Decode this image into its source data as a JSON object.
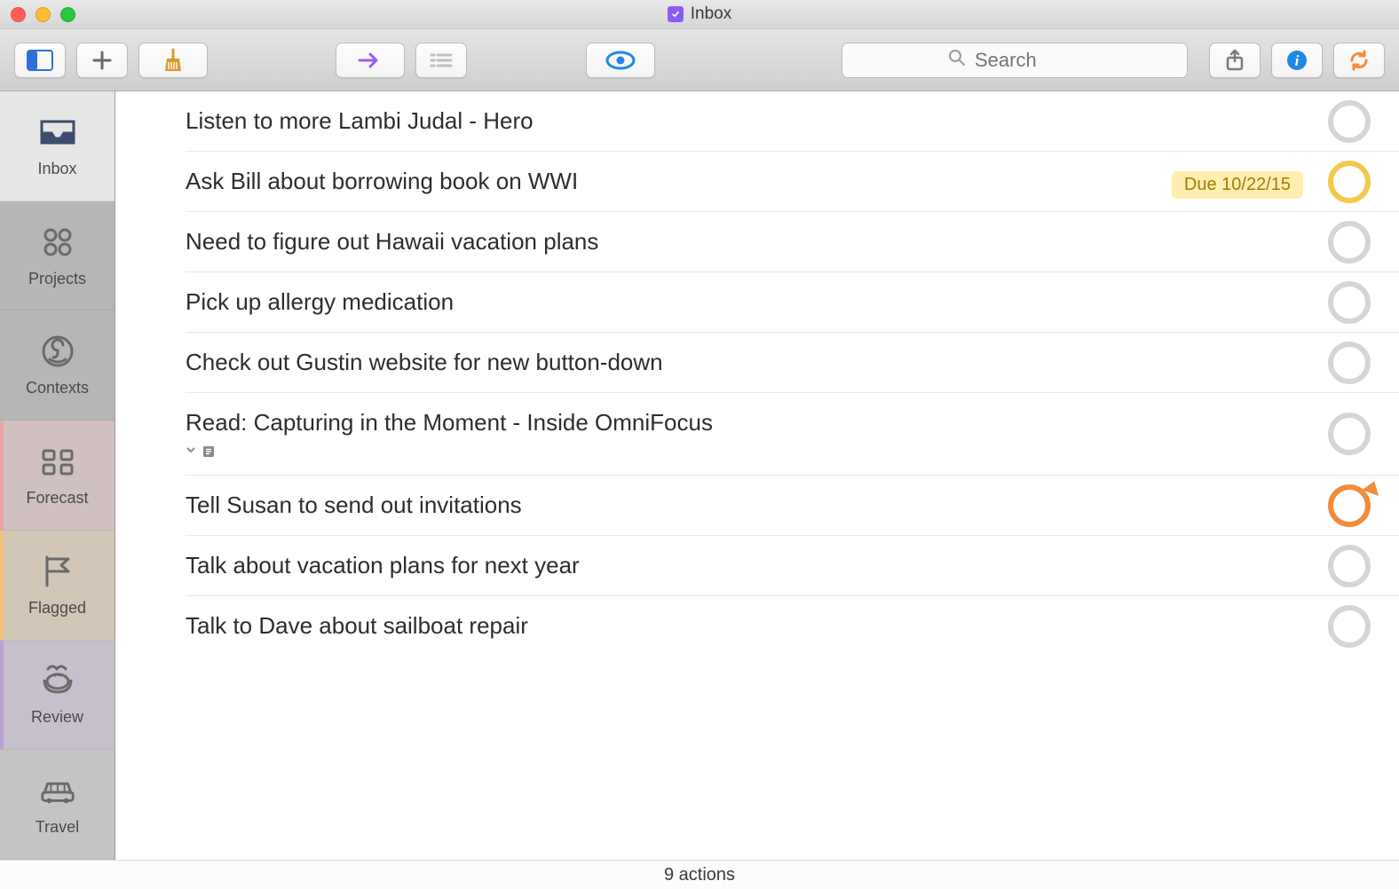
{
  "window": {
    "title": "Inbox"
  },
  "search": {
    "placeholder": "Search"
  },
  "sidebar": {
    "items": [
      {
        "label": "Inbox"
      },
      {
        "label": "Projects"
      },
      {
        "label": "Contexts"
      },
      {
        "label": "Forecast"
      },
      {
        "label": "Flagged"
      },
      {
        "label": "Review"
      },
      {
        "label": "Travel"
      }
    ]
  },
  "tasks": [
    {
      "title": "Listen to more Lambi Judal - Hero",
      "status": "normal"
    },
    {
      "title": "Ask Bill about borrowing book on WWI",
      "status": "due",
      "due": "Due 10/22/15"
    },
    {
      "title": "Need to figure out Hawaii vacation plans",
      "status": "normal"
    },
    {
      "title": "Pick up allergy medication",
      "status": "normal"
    },
    {
      "title": "Check out Gustin website for new button-down",
      "status": "normal"
    },
    {
      "title": "Read: Capturing in the Moment - Inside OmniFocus",
      "status": "normal",
      "has_note": true
    },
    {
      "title": "Tell Susan to send out invitations",
      "status": "flagged"
    },
    {
      "title": "Talk about vacation plans for next year",
      "status": "normal"
    },
    {
      "title": "Talk to Dave about sailboat repair",
      "status": "normal"
    }
  ],
  "footer": {
    "summary": "9 actions"
  }
}
